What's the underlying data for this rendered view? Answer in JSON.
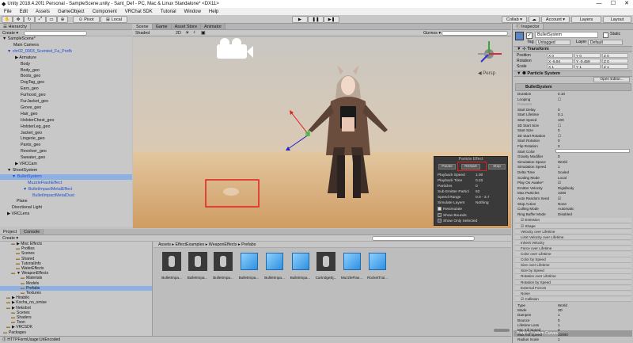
{
  "window": {
    "title": "Unity 2018.4.20f1 Personal - SampleScene.unity - Sant_Def - PC, Mac & Linux Standalone* <DX11>"
  },
  "menu": [
    "File",
    "Edit",
    "Assets",
    "GameObject",
    "Component",
    "VRChat SDK",
    "Tutorial",
    "Window",
    "Help"
  ],
  "toolbar": {
    "pivot": "Pivot",
    "local": "Local",
    "collab": "Collab ▾",
    "account": "Account ▾",
    "layers": "Layers",
    "layout": "Layout"
  },
  "hierarchy": {
    "tab": "Hierarchy",
    "create": "Create ▾",
    "search": "All",
    "rows": [
      {
        "t": "▼ SampleScene*",
        "x": 3,
        "s": 0,
        "b": 0
      },
      {
        "t": "Main Camera",
        "x": 17,
        "s": 0,
        "b": 0
      },
      {
        "t": "▼ chr02_0003_Scented_Fa_Prefb",
        "x": 9,
        "s": 0,
        "b": 1
      },
      {
        "t": "▶ Armature",
        "x": 19,
        "s": 0,
        "b": 0
      },
      {
        "t": "Body",
        "x": 26,
        "s": 0,
        "b": 0
      },
      {
        "t": "Body_geo",
        "x": 26,
        "s": 0,
        "b": 0
      },
      {
        "t": "Boots_geo",
        "x": 26,
        "s": 0,
        "b": 0
      },
      {
        "t": "DogTag_geo",
        "x": 26,
        "s": 0,
        "b": 0
      },
      {
        "t": "Ears_geo",
        "x": 26,
        "s": 0,
        "b": 0
      },
      {
        "t": "Furhood_geo",
        "x": 26,
        "s": 0,
        "b": 0
      },
      {
        "t": "FurJacket_geo",
        "x": 26,
        "s": 0,
        "b": 0
      },
      {
        "t": "Grove_geo",
        "x": 26,
        "s": 0,
        "b": 0
      },
      {
        "t": "Hair_geo",
        "x": 26,
        "s": 0,
        "b": 0
      },
      {
        "t": "HolsterChest_geo",
        "x": 26,
        "s": 0,
        "b": 0
      },
      {
        "t": "HolsterLeg_geo",
        "x": 26,
        "s": 0,
        "b": 0
      },
      {
        "t": "Jacket_geo",
        "x": 26,
        "s": 0,
        "b": 0
      },
      {
        "t": "Lingerie_geo",
        "x": 26,
        "s": 0,
        "b": 0
      },
      {
        "t": "Pants_geo",
        "x": 26,
        "s": 0,
        "b": 0
      },
      {
        "t": "Revolver_geo",
        "x": 26,
        "s": 0,
        "b": 0
      },
      {
        "t": "Sweater_geo",
        "x": 26,
        "s": 0,
        "b": 0
      },
      {
        "t": "▶ VRCCam",
        "x": 19,
        "s": 0,
        "b": 0
      },
      {
        "t": "▼ ShootSystem",
        "x": 9,
        "s": 0,
        "b": 0
      },
      {
        "t": "▼ BulletSystem",
        "x": 15,
        "s": 1,
        "b": 1
      },
      {
        "t": "MuzzleFlashEffect",
        "x": 35,
        "s": 0,
        "b": 1
      },
      {
        "t": "▼ BulletImpactMetalEffect",
        "x": 29,
        "s": 0,
        "b": 1
      },
      {
        "t": "BulletImpactMetalDust",
        "x": 41,
        "s": 0,
        "b": 1
      },
      {
        "t": "Plane",
        "x": 21,
        "s": 0,
        "b": 0
      },
      {
        "t": "Directional Light",
        "x": 15,
        "s": 0,
        "b": 0
      },
      {
        "t": "▶ VRCLens",
        "x": 9,
        "s": 0,
        "b": 0
      }
    ]
  },
  "scene": {
    "tabs": [
      "Scene",
      "Game",
      "Asset Store",
      "Animator"
    ],
    "shading": "Shaded",
    "mode": "2D",
    "gizmos": "Gizmos ▾",
    "search": "All"
  },
  "pe": {
    "title": "Particle Effect",
    "pause": "Pause",
    "restart": "Restart",
    "stop": "Stop",
    "rows": [
      {
        "l": "Playback Speed",
        "v": "1.00"
      },
      {
        "l": "Playback Time",
        "v": "0.22"
      },
      {
        "l": "Particles",
        "v": "0"
      },
      {
        "l": "Sub Emitter Particl",
        "v": "62"
      },
      {
        "l": "Speed Range",
        "v": "0.0 - 3.7"
      },
      {
        "l": "Simulate Layers",
        "v": "Nothing"
      }
    ],
    "checks": [
      "Resimulate",
      "Show Bounds",
      "Show Only Selected"
    ]
  },
  "project": {
    "tabs": [
      "Project",
      "Console"
    ],
    "create": "Create ▾",
    "tree": [
      {
        "t": "▶ Misc Effects",
        "x": 14
      },
      {
        "t": "Profiles",
        "x": 20
      },
      {
        "t": "Scenes",
        "x": 20
      },
      {
        "t": "Shared",
        "x": 20
      },
      {
        "t": "TutorialInfo",
        "x": 20
      },
      {
        "t": "WaterEffects",
        "x": 20
      },
      {
        "t": "▼ WeaponEffects",
        "x": 14
      },
      {
        "t": "Materials",
        "x": 26
      },
      {
        "t": "Models",
        "x": 26
      },
      {
        "t": "Prefabs",
        "x": 26,
        "sel": 1
      },
      {
        "t": "Textures",
        "x": 26
      },
      {
        "t": "▶ Hirabiki",
        "x": 8
      },
      {
        "t": "▶ Kocha_no_omise",
        "x": 8
      },
      {
        "t": "▶ Nekobot",
        "x": 8
      },
      {
        "t": "Scenes",
        "x": 14
      },
      {
        "t": "Shaders",
        "x": 14
      },
      {
        "t": "Toon",
        "x": 14
      },
      {
        "t": "▶ VRCSDK",
        "x": 8
      },
      {
        "t": "Packages",
        "x": 4
      }
    ],
    "breadcrumb": "Assets ▸ EffectExamples ▸ WeaponEffects ▸ Prefabs",
    "items": [
      {
        "n": "BulletImpa...",
        "k": "mesh"
      },
      {
        "n": "BulletImpa...",
        "k": "mesh"
      },
      {
        "n": "BulletImpa...",
        "k": "mesh"
      },
      {
        "n": "BulletImpa...",
        "k": "cube"
      },
      {
        "n": "BulletImpa...",
        "k": "cube"
      },
      {
        "n": "BulletImpa...",
        "k": "cube"
      },
      {
        "n": "CartridgeEj...",
        "k": "mesh"
      },
      {
        "n": "MuzzleFlas...",
        "k": "cube"
      },
      {
        "n": "RocketTrai...",
        "k": "cube"
      }
    ],
    "status": "HTTPFormUsage:UriEncoded"
  },
  "inspector": {
    "tab": "Inspector",
    "name": "BulletSystem",
    "static": "Static",
    "tag_label": "Tag",
    "tag": "Untagged",
    "layer_label": "Layer",
    "layer": "Default",
    "transform": {
      "title": "Transform",
      "rows": [
        {
          "l": "Position",
          "x": "X 0",
          "y": "Y 0",
          "z": "Z 0"
        },
        {
          "l": "Rotation",
          "x": "X -5.94",
          "y": "Y -0.459",
          "z": "Z 0"
        },
        {
          "l": "Scale",
          "x": "X 1",
          "y": "Y 1",
          "z": "Z 1"
        }
      ]
    },
    "ps_title": "Particle System",
    "open_editor": "Open Editor...",
    "ps_name": "BulletSystem",
    "props": [
      {
        "l": "Duration",
        "v": "0.10"
      },
      {
        "l": "Looping",
        "v": "☐"
      },
      {
        "l": "Prewarm",
        "v": ""
      },
      {
        "l": "Start Delay",
        "v": "0"
      },
      {
        "l": "Start Lifetime",
        "v": "0.1"
      },
      {
        "l": "Start Speed",
        "v": "100"
      },
      {
        "l": "3D Start Size",
        "v": "☐"
      },
      {
        "l": "Start Size",
        "v": "0"
      },
      {
        "l": "3D Start Rotation",
        "v": "☐"
      },
      {
        "l": "Start Rotation",
        "v": "0"
      },
      {
        "l": "Flip Rotation",
        "v": "0"
      },
      {
        "l": "Start Color",
        "v": ""
      },
      {
        "l": "Gravity Modifier",
        "v": "0"
      },
      {
        "l": "Simulation Space",
        "v": "World"
      },
      {
        "l": "Simulation Speed",
        "v": "1"
      },
      {
        "l": "Delta Time",
        "v": "Scaled"
      },
      {
        "l": "Scaling Mode",
        "v": "Local"
      },
      {
        "l": "Play On Awake*",
        "v": "☑"
      },
      {
        "l": "Emitter Velocity",
        "v": "Rigidbody"
      },
      {
        "l": "Max Particles",
        "v": "1000"
      },
      {
        "l": "Auto Random Seed",
        "v": "☑"
      },
      {
        "l": "Stop Action",
        "v": "None"
      },
      {
        "l": "Culling Mode",
        "v": "Automatic"
      },
      {
        "l": "Ring Buffer Mode",
        "v": "Disabled"
      }
    ],
    "modules": [
      {
        "t": "☑ Emission",
        "on": 1
      },
      {
        "t": "☑ Shape",
        "on": 1
      },
      {
        "t": "Velocity over Lifetime",
        "on": 0
      },
      {
        "t": "Limit Velocity over Lifetime",
        "on": 0
      },
      {
        "t": "Inherit Velocity",
        "on": 0
      },
      {
        "t": "Force over Lifetime",
        "on": 0
      },
      {
        "t": "Color over Lifetime",
        "on": 0
      },
      {
        "t": "Color by Speed",
        "on": 0
      },
      {
        "t": "Size over Lifetime",
        "on": 0
      },
      {
        "t": "Size by Speed",
        "on": 0
      },
      {
        "t": "Rotation over Lifetime",
        "on": 0
      },
      {
        "t": "Rotation by Speed",
        "on": 0
      },
      {
        "t": "External Forces",
        "on": 0
      },
      {
        "t": "Noise",
        "on": 0
      },
      {
        "t": "☑ Collision",
        "on": 1
      }
    ],
    "collision": [
      {
        "l": "Type",
        "v": "World"
      },
      {
        "l": "Mode",
        "v": "3D"
      },
      {
        "l": "Dampen",
        "v": "1"
      },
      {
        "l": "Bounce",
        "v": "0"
      },
      {
        "l": "Lifetime Loss",
        "v": "1"
      },
      {
        "l": "Min Kill Speed",
        "v": "0"
      },
      {
        "l": "Max Kill Speed",
        "v": "10000"
      },
      {
        "l": "Radius Scale",
        "v": "1"
      }
    ],
    "curves": "Particle System Curves"
  },
  "colors": {
    "selection": "#8eb1e3",
    "highlight": "#e02020",
    "blue_text": "#1b4fd0",
    "sky": "#d7c6b3",
    "ground": "#d7ad7c"
  }
}
